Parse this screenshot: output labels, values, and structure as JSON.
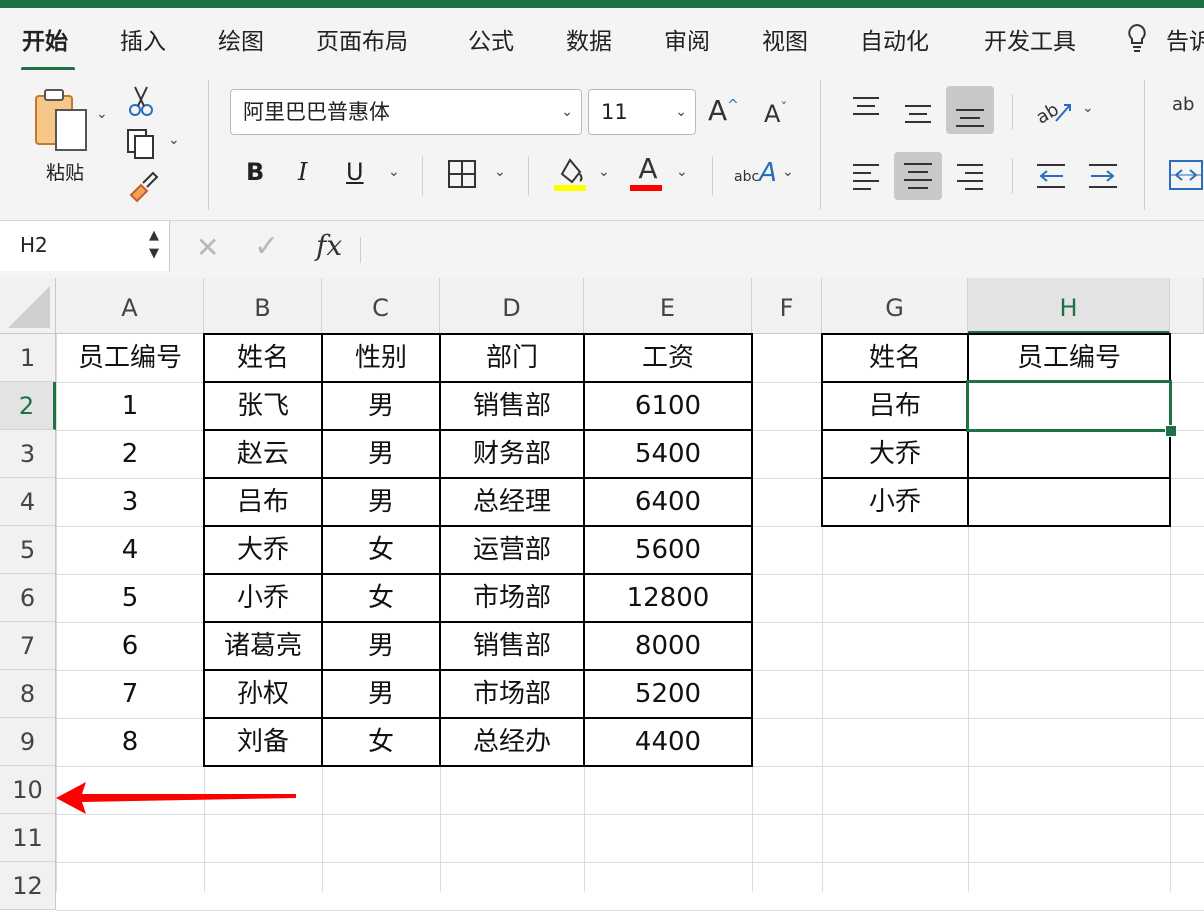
{
  "tabs": [
    "开始",
    "插入",
    "绘图",
    "页面布局",
    "公式",
    "数据",
    "审阅",
    "视图",
    "自动化",
    "开发工具",
    "告诉"
  ],
  "ribbon": {
    "paste_label": "粘贴",
    "font_name": "阿里巴巴普惠体",
    "font_size": "11",
    "bold": "B",
    "italic": "I",
    "underline": "U",
    "font_color_glyph": "A",
    "grow_glyph": "A",
    "shrink_glyph": "A",
    "abc_glyph": "abc",
    "wrap_glyph": "ab",
    "highlight_color": "#ffff00",
    "font_color": "#ff0000"
  },
  "formula_bar": {
    "name_box": "H2",
    "fx_label": "fx",
    "formula": ""
  },
  "columns": [
    "A",
    "B",
    "C",
    "D",
    "E",
    "F",
    "G",
    "H"
  ],
  "selected_column": "H",
  "selected_row": "2",
  "rows": [
    "1",
    "2",
    "3",
    "4",
    "5",
    "6",
    "7",
    "8",
    "9",
    "10",
    "11",
    "12"
  ],
  "table1": {
    "headers": [
      "员工编号",
      "姓名",
      "性别",
      "部门",
      "工资"
    ],
    "data": [
      [
        "1",
        "张飞",
        "男",
        "销售部",
        "6100"
      ],
      [
        "2",
        "赵云",
        "男",
        "财务部",
        "5400"
      ],
      [
        "3",
        "吕布",
        "男",
        "总经理",
        "6400"
      ],
      [
        "4",
        "大乔",
        "女",
        "运营部",
        "5600"
      ],
      [
        "5",
        "小乔",
        "女",
        "市场部",
        "12800"
      ],
      [
        "6",
        "诸葛亮",
        "男",
        "销售部",
        "8000"
      ],
      [
        "7",
        "孙权",
        "男",
        "市场部",
        "5200"
      ],
      [
        "8",
        "刘备",
        "女",
        "总经办",
        "4400"
      ]
    ]
  },
  "table2": {
    "headers": [
      "姓名",
      "员工编号"
    ],
    "data": [
      [
        "吕布",
        ""
      ],
      [
        "大乔",
        ""
      ],
      [
        "小乔",
        ""
      ]
    ]
  },
  "colors": {
    "accent": "#1e7145",
    "arrow": "#ff0000"
  }
}
